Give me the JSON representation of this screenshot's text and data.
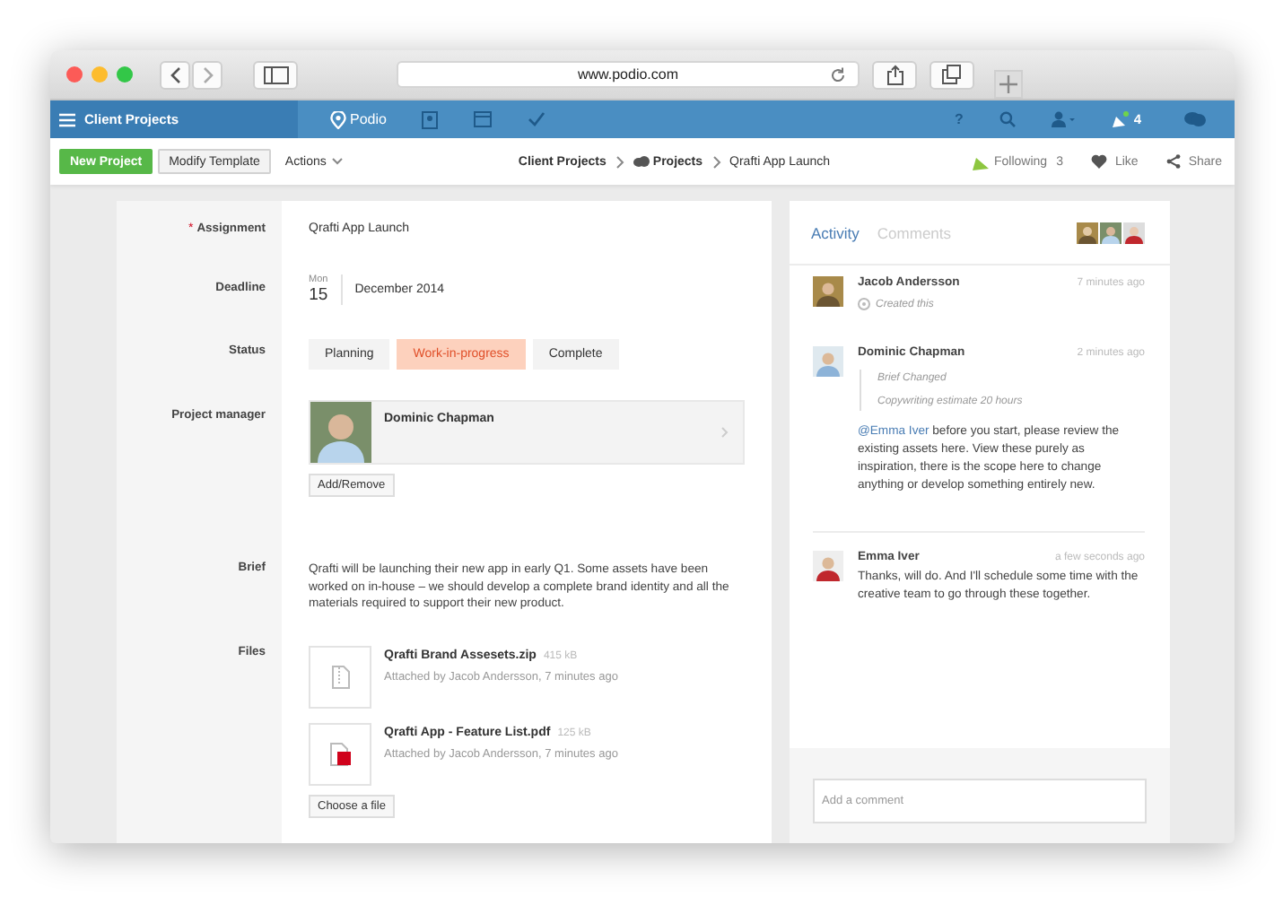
{
  "browser": {
    "url": "www.podio.com"
  },
  "app_bar": {
    "workspace": "Client Projects",
    "brand": "Podio",
    "help": "?",
    "notifications": "4"
  },
  "toolbar": {
    "buttons": [
      {
        "label": "New Project",
        "kind": "primary"
      },
      {
        "label": "Modify Template",
        "kind": "default"
      }
    ],
    "actions": "Actions",
    "breadcrumb": [
      {
        "label": "Client Projects",
        "kind": "link"
      },
      {
        "label": "Projects",
        "kind": "app"
      },
      {
        "label": "Qrafti App Launch",
        "kind": "current"
      }
    ],
    "following": {
      "label": "Following",
      "count": "3"
    },
    "like": "Like",
    "share": "Share"
  },
  "fields": [
    {
      "kind": "text",
      "label": "Assignment",
      "marker": "*",
      "value": "Qrafti App Launch"
    },
    {
      "kind": "date",
      "label": "Deadline",
      "weekday": "Mon",
      "day": "15",
      "month": "December 2014"
    },
    {
      "kind": "category",
      "label": "Status",
      "options": [
        {
          "label": "Planning",
          "selected": false
        },
        {
          "label": "Work-in-progress",
          "selected": true
        },
        {
          "label": "Complete",
          "selected": false
        }
      ]
    },
    {
      "kind": "contact",
      "label": "Project manager",
      "name": "Dominic Chapman",
      "button": "Add/Remove"
    },
    {
      "kind": "textblock",
      "label": "Brief",
      "value": "Qrafti will be launching their new app in early Q1. Some assets have been worked on in-house – we should develop a complete brand identity and all the materials required to support their new product."
    },
    {
      "kind": "files",
      "label": "Files",
      "files": [
        {
          "kind": "zip",
          "name": "Qrafti Brand Assesets.zip",
          "size": "415 kB",
          "meta": "Attached by Jacob Andersson, 7 minutes ago"
        },
        {
          "kind": "pdf",
          "name": "Qrafti App - Feature List.pdf",
          "size": "125 kB",
          "meta": "Attached by Jacob Andersson, 7 minutes ago"
        }
      ],
      "button": "Choose a file"
    }
  ],
  "activity": {
    "tabs": [
      {
        "label": "Activity",
        "selected": true
      },
      {
        "label": "Comments",
        "selected": false
      }
    ],
    "entries": [
      {
        "kind": "event",
        "author": "Jacob Andersson",
        "time": "7 minutes ago",
        "text": "Created this"
      },
      {
        "kind": "change",
        "author": "Dominic Chapman",
        "time": "2 minutes ago",
        "changes": [
          "Brief Changed",
          "Copywriting estimate 20 hours"
        ],
        "mention": "@Emma Iver",
        "text": "before you start, please review the existing assets here. View these purely as inspiration, there is the scope here to change anything or develop something entirely new."
      },
      {
        "kind": "comment",
        "author": "Emma Iver",
        "time": "a few seconds ago",
        "text": "Thanks, will do. And I'll schedule some time with the creative team to go through these together."
      }
    ],
    "comment": {
      "placeholder": "Add a comment"
    }
  }
}
